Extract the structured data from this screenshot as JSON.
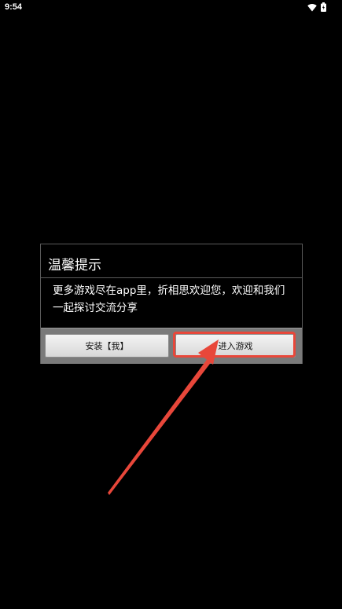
{
  "status_bar": {
    "time": "9:54",
    "icons": [
      "wifi-icon",
      "battery-icon"
    ]
  },
  "dialog": {
    "title": "温馨提示",
    "message": "更多游戏尽在app里，折相思欢迎您，欢迎和我们一起探讨交流分享",
    "buttons": {
      "install_label": "安装【我】",
      "enter_label": "进入游戏"
    }
  },
  "annotation": {
    "color": "#e8473a"
  }
}
